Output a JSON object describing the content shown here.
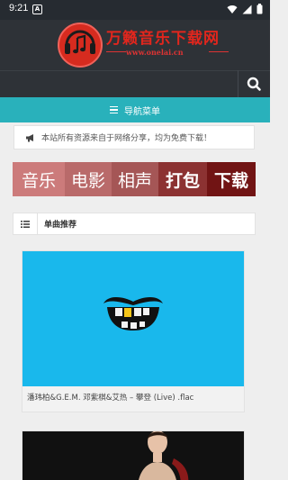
{
  "status_bar": {
    "time": "9:21",
    "notification_glyph": "A",
    "icons": [
      "wifi-icon",
      "signal-icon",
      "battery-icon"
    ]
  },
  "header": {
    "site_title": "万籁音乐下载网",
    "site_url": "www.onelai.cn",
    "logo_icon": "music-note-icon"
  },
  "search": {
    "icon": "search-icon"
  },
  "nav": {
    "label": "导航菜单",
    "icon": "menu-icon"
  },
  "notice": {
    "icon": "megaphone-icon",
    "text": "本站所有资源来自于网络分享，均为免费下载！"
  },
  "categories": [
    {
      "label": "音乐"
    },
    {
      "label": "电影"
    },
    {
      "label": "相声"
    },
    {
      "label": "打包"
    },
    {
      "label": "下载"
    }
  ],
  "section": {
    "title": "单曲推荐",
    "icon": "list-icon"
  },
  "posts": [
    {
      "caption": "潘玮柏&G.E.M. 邓紫棋&艾热 – 攀登 (Live) .flac"
    }
  ],
  "colors": {
    "nav_bar": "#29b1bb",
    "header_bg": "#2e3237",
    "logo_red": "#e2261d",
    "thumb_blue": "#19b8ec"
  }
}
